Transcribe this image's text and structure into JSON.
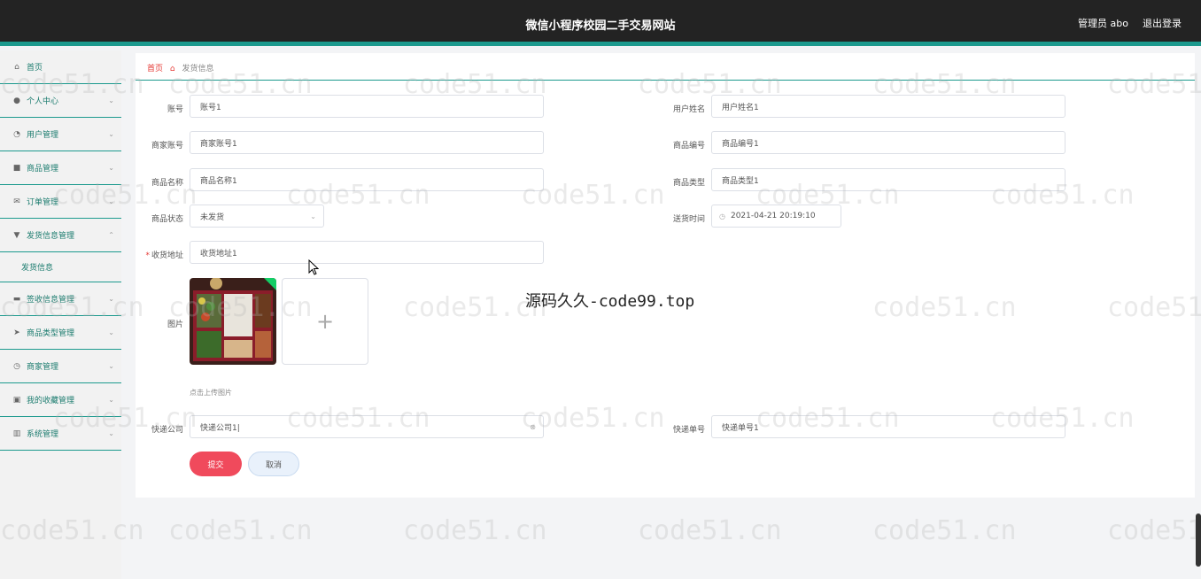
{
  "header": {
    "title": "微信小程序校园二手交易网站",
    "user": "管理员 abo",
    "logout": "退出登录"
  },
  "sidebar": {
    "items": [
      {
        "label": "首页",
        "icon": "home-icon",
        "glyph": "⌂",
        "expandable": false
      },
      {
        "label": "个人中心",
        "icon": "user-icon",
        "glyph": "●",
        "expandable": true
      },
      {
        "label": "用户管理",
        "icon": "gauge-icon",
        "glyph": "◔",
        "expandable": true
      },
      {
        "label": "商品管理",
        "icon": "bag-icon",
        "glyph": "■",
        "expandable": true
      },
      {
        "label": "订单管理",
        "icon": "mail-icon",
        "glyph": "✉",
        "expandable": true
      },
      {
        "label": "发货信息管理",
        "icon": "pin-icon",
        "glyph": "▼",
        "expandable": true,
        "expanded": true,
        "children": [
          "发货信息"
        ]
      },
      {
        "label": "签收信息管理",
        "icon": "chat-icon",
        "glyph": "▬",
        "expandable": true
      },
      {
        "label": "商品类型管理",
        "icon": "send-icon",
        "glyph": "➤",
        "expandable": true
      },
      {
        "label": "商家管理",
        "icon": "clock-icon",
        "glyph": "◷",
        "expandable": true
      },
      {
        "label": "我的收藏管理",
        "icon": "image-icon",
        "glyph": "▣",
        "expandable": true
      },
      {
        "label": "系统管理",
        "icon": "chart-icon",
        "glyph": "▥",
        "expandable": true
      }
    ]
  },
  "breadcrumb": {
    "home": "首页",
    "current": "发货信息"
  },
  "form": {
    "account_label": "账号",
    "account_value": "账号1",
    "username_label": "用户姓名",
    "username_value": "用户姓名1",
    "merchant_label": "商家账号",
    "merchant_value": "商家账号1",
    "product_no_label": "商品编号",
    "product_no_value": "商品编号1",
    "product_name_label": "商品名称",
    "product_name_value": "商品名称1",
    "product_type_label": "商品类型",
    "product_type_value": "商品类型1",
    "status_label": "商品状态",
    "status_value": "未发货",
    "ship_time_label": "送货时间",
    "ship_time_value": "2021-04-21 20:19:10",
    "address_label": "收货地址",
    "address_value": "收货地址1",
    "image_label": "图片",
    "upload_hint": "点击上传图片",
    "courier_label": "快递公司",
    "courier_value": "快递公司1|",
    "tracking_label": "快递单号",
    "tracking_value": "快递单号1",
    "submit": "提交",
    "cancel": "取消"
  },
  "overlay": "源码久久-code99.top",
  "watermark": "code51.cn",
  "colors": {
    "accent": "#1c9a8e",
    "topbar": "#232323",
    "danger": "#f04a5c"
  }
}
